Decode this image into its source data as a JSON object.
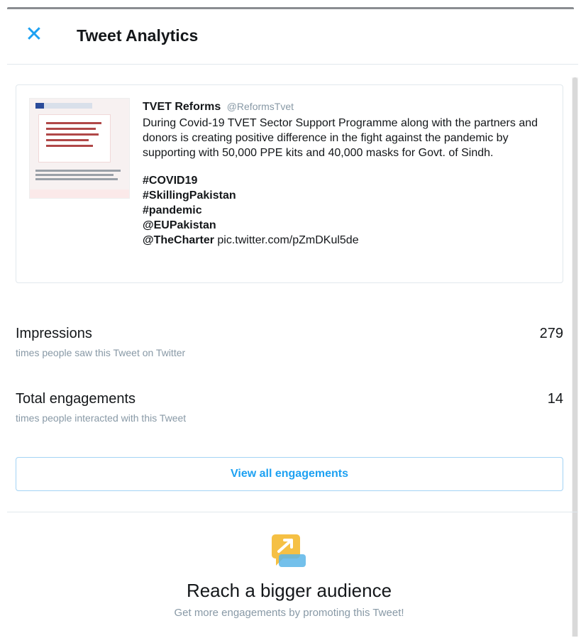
{
  "header": {
    "close_symbol": "✕",
    "title": "Tweet Analytics"
  },
  "tweet": {
    "author_name": "TVET Reforms",
    "author_handle": "@ReformsTvet",
    "text": "During Covid-19 TVET Sector Support Programme along with the partners and donors is creating positive difference in the fight against the pandemic by supporting with 50,000 PPE kits and 40,000 masks for Govt. of Sindh.",
    "tags": [
      "#COVID19",
      "#SkillingPakistan",
      "#pandemic",
      "@EUPakistan"
    ],
    "last_tag": "@TheCharter",
    "link": "pic.twitter.com/pZmDKul5de"
  },
  "metrics": [
    {
      "label": "Impressions",
      "value": "279",
      "description": "times people saw this Tweet on Twitter"
    },
    {
      "label": "Total engagements",
      "value": "14",
      "description": "times people interacted with this Tweet"
    }
  ],
  "view_all_label": "View all engagements",
  "promo": {
    "title": "Reach a bigger audience",
    "description": "Get more engagements by promoting this Tweet!"
  },
  "colors": {
    "accent": "#1da1f2",
    "promo_icon": "#f5c044"
  },
  "icons": {
    "close": "close-icon",
    "promo": "promote-chart-icon"
  }
}
